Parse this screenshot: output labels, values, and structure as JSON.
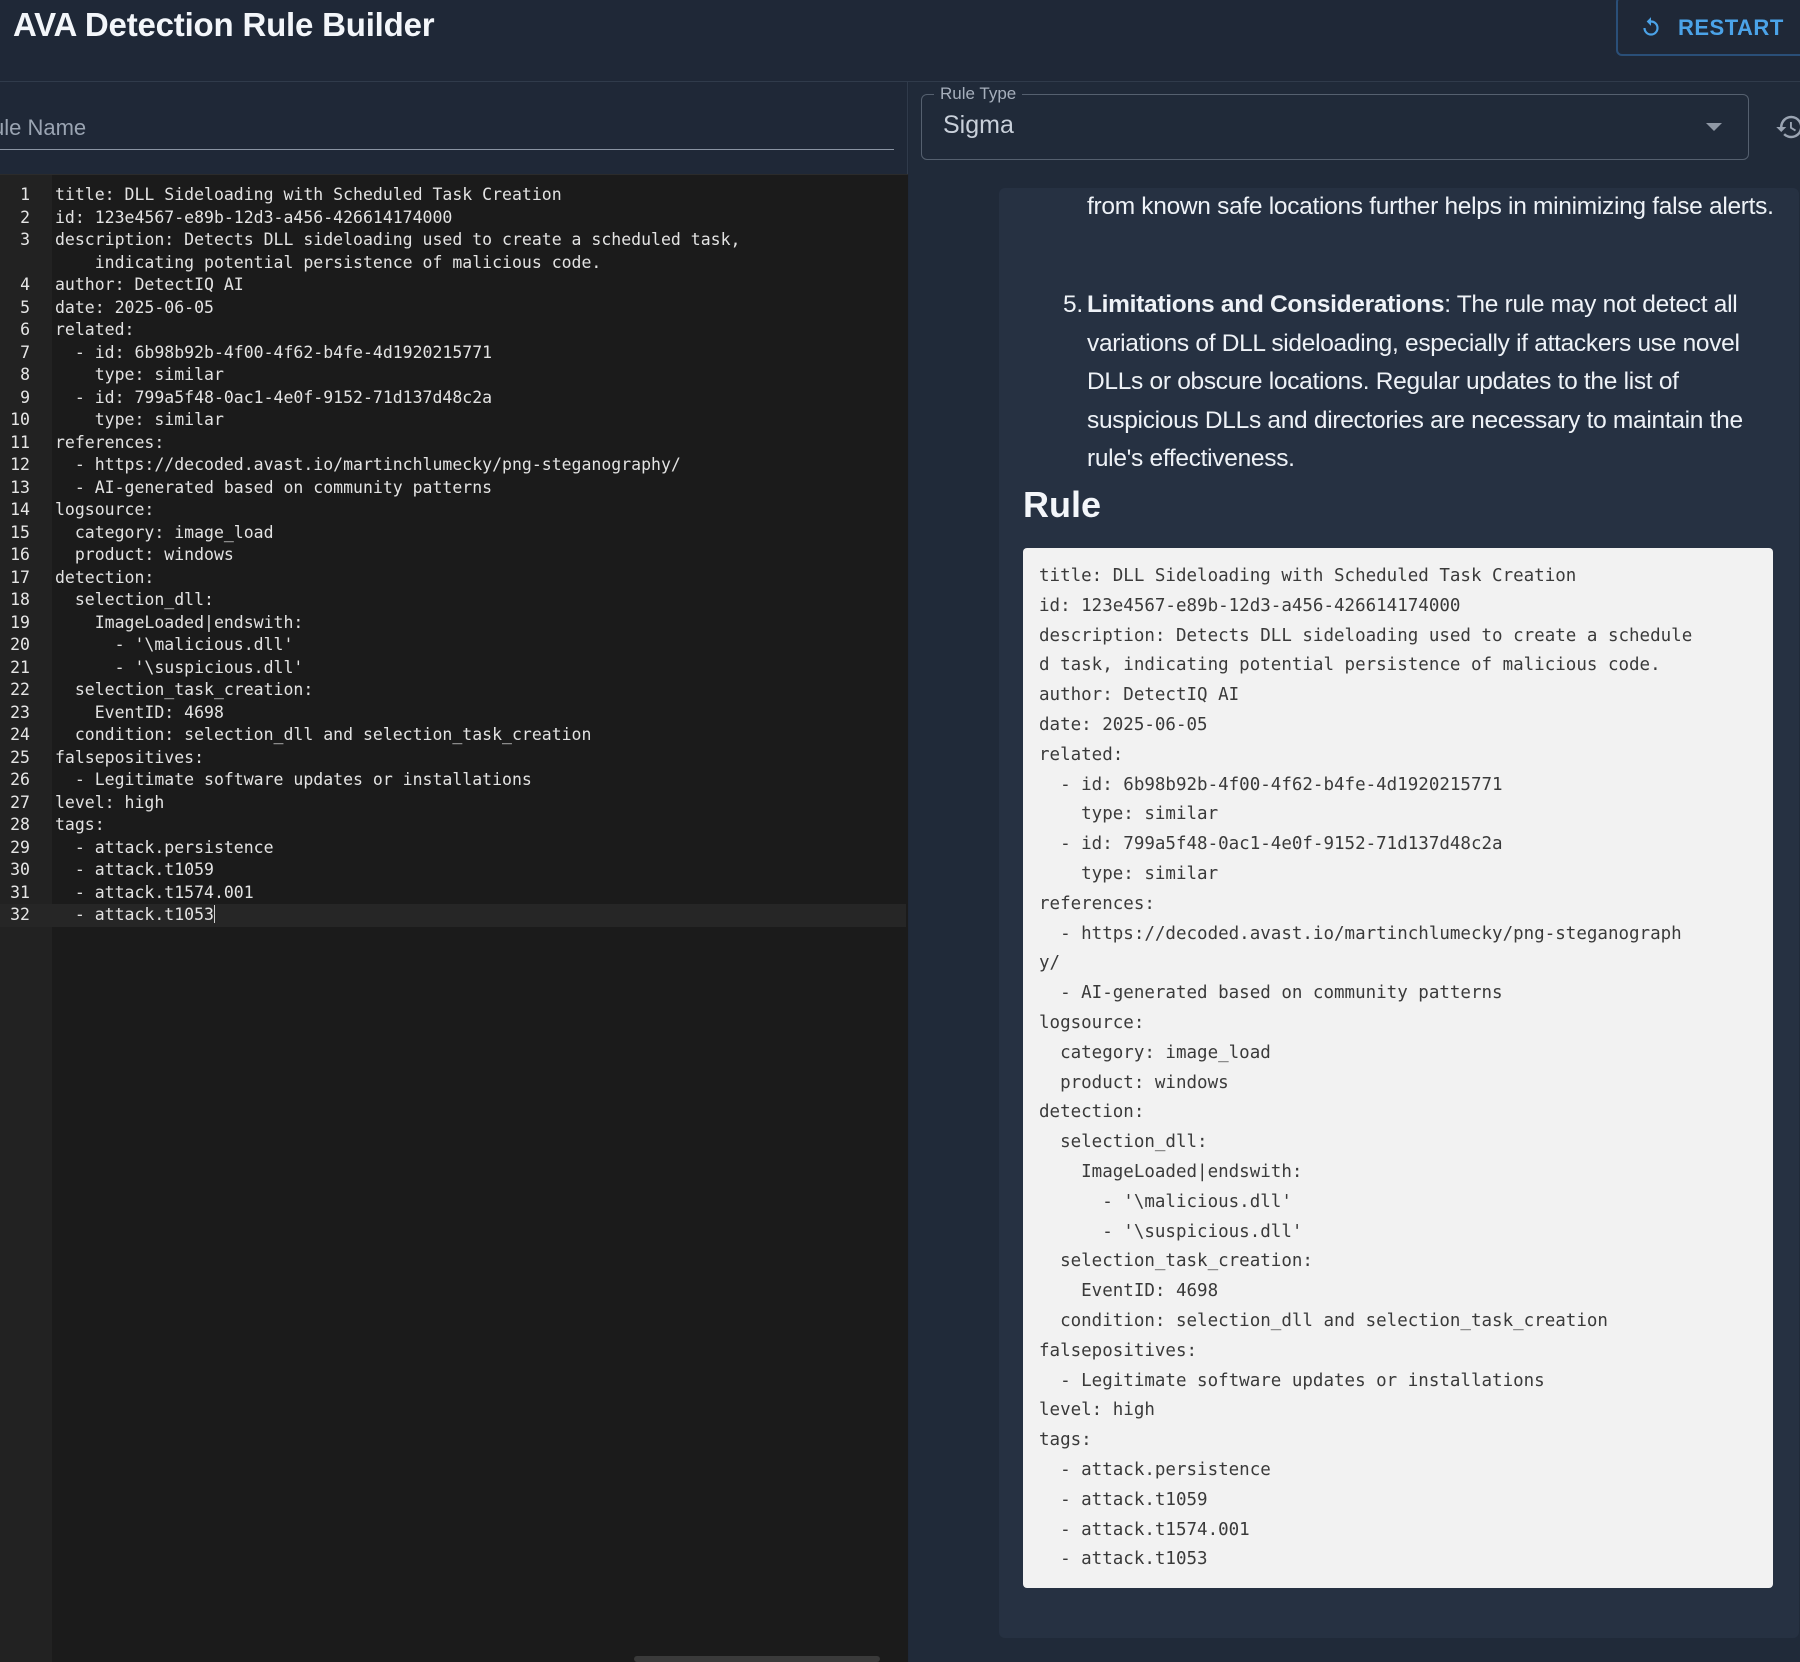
{
  "header": {
    "title": "AVA Detection Rule Builder",
    "restart_label": "RESTART"
  },
  "rule_name": {
    "placeholder": "ule Name"
  },
  "rule_type": {
    "legend": "Rule Type",
    "value": "Sigma"
  },
  "editor": {
    "lines": [
      {
        "n": "1",
        "text": "title: DLL Sideloading with Scheduled Task Creation"
      },
      {
        "n": "2",
        "text": "id: 123e4567-e89b-12d3-a456-426614174000"
      },
      {
        "n": "3",
        "text": "description: Detects DLL sideloading used to create a scheduled task,"
      },
      {
        "n": "",
        "text": "    indicating potential persistence of malicious code."
      },
      {
        "n": "4",
        "text": "author: DetectIQ AI"
      },
      {
        "n": "5",
        "text": "date: 2025-06-05"
      },
      {
        "n": "6",
        "text": "related:"
      },
      {
        "n": "7",
        "text": "  - id: 6b98b92b-4f00-4f62-b4fe-4d1920215771"
      },
      {
        "n": "8",
        "text": "    type: similar"
      },
      {
        "n": "9",
        "text": "  - id: 799a5f48-0ac1-4e0f-9152-71d137d48c2a"
      },
      {
        "n": "10",
        "text": "    type: similar"
      },
      {
        "n": "11",
        "text": "references:"
      },
      {
        "n": "12",
        "text": "  - https://decoded.avast.io/martinchlumecky/png-steganography/"
      },
      {
        "n": "13",
        "text": "  - AI-generated based on community patterns"
      },
      {
        "n": "14",
        "text": "logsource:"
      },
      {
        "n": "15",
        "text": "  category: image_load"
      },
      {
        "n": "16",
        "text": "  product: windows"
      },
      {
        "n": "17",
        "text": "detection:"
      },
      {
        "n": "18",
        "text": "  selection_dll:"
      },
      {
        "n": "19",
        "text": "    ImageLoaded|endswith:"
      },
      {
        "n": "20",
        "text": "      - '\\malicious.dll'"
      },
      {
        "n": "21",
        "text": "      - '\\suspicious.dll'"
      },
      {
        "n": "22",
        "text": "  selection_task_creation:"
      },
      {
        "n": "23",
        "text": "    EventID: 4698"
      },
      {
        "n": "24",
        "text": "  condition: selection_dll and selection_task_creation"
      },
      {
        "n": "25",
        "text": "falsepositives:"
      },
      {
        "n": "26",
        "text": "  - Legitimate software updates or installations"
      },
      {
        "n": "27",
        "text": "level: high"
      },
      {
        "n": "28",
        "text": "tags:"
      },
      {
        "n": "29",
        "text": "  - attack.persistence"
      },
      {
        "n": "30",
        "text": "  - attack.t1059"
      },
      {
        "n": "31",
        "text": "  - attack.t1574.001"
      },
      {
        "n": "32",
        "text": "  - attack.t1053"
      }
    ]
  },
  "analysis": {
    "continuation": "from known safe locations further helps in minimizing false alerts.",
    "item5_number": "5.",
    "item5_title": "Limitations and Considerations",
    "item5_text": ": The rule may not detect all variations of DLL sideloading, especially if attackers use novel DLLs or obscure locations. Regular updates to the list of suspicious DLLs and directories are necessary to maintain the rule's effectiveness.",
    "rule_heading": "Rule",
    "rule_text": "title: DLL Sideloading with Scheduled Task Creation\nid: 123e4567-e89b-12d3-a456-426614174000\ndescription: Detects DLL sideloading used to create a schedule\nd task, indicating potential persistence of malicious code.\nauthor: DetectIQ AI\ndate: 2025-06-05\nrelated:\n  - id: 6b98b92b-4f00-4f62-b4fe-4d1920215771\n    type: similar\n  - id: 799a5f48-0ac1-4e0f-9152-71d137d48c2a\n    type: similar\nreferences:\n  - https://decoded.avast.io/martinchlumecky/png-steganograph\ny/\n  - AI-generated based on community patterns\nlogsource:\n  category: image_load\n  product: windows\ndetection:\n  selection_dll:\n    ImageLoaded|endswith:\n      - '\\malicious.dll'\n      - '\\suspicious.dll'\n  selection_task_creation:\n    EventID: 4698\n  condition: selection_dll and selection_task_creation\nfalsepositives:\n  - Legitimate software updates or installations\nlevel: high\ntags:\n  - attack.persistence\n  - attack.t1059\n  - attack.t1574.001\n  - attack.t1053"
  },
  "colors": {
    "accent": "#4ba3e8",
    "background": "#1f2837",
    "editor_bg": "#1b1b1b",
    "rule_box_bg": "#f2f2f2"
  },
  "icons": {
    "restart": "restart-icon",
    "dropdown": "chevron-down-icon",
    "history": "history-icon"
  }
}
